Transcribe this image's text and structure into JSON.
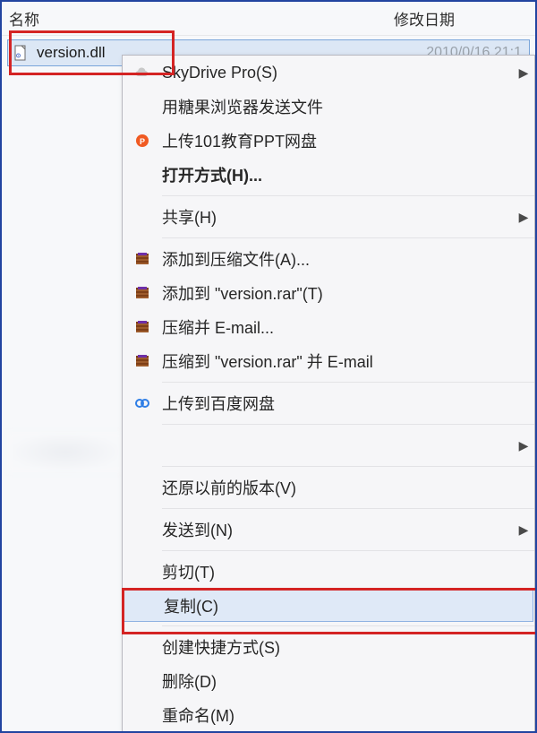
{
  "columns": {
    "name": "名称",
    "date": "修改日期"
  },
  "file": {
    "name": "version.dll",
    "date": "2010/0/16  21:1"
  },
  "menu": {
    "skydrive": "SkyDrive Pro(S)",
    "candy": "用糖果浏览器发送文件",
    "ppt101": "上传101教育PPT网盘",
    "openwith": "打开方式(H)...",
    "share": "共享(H)",
    "rarAdd": "添加到压缩文件(A)...",
    "rarAddName": "添加到 \"version.rar\"(T)",
    "rarEmail": "压缩并 E-mail...",
    "rarEmailName": "压缩到 \"version.rar\" 并 E-mail",
    "baidu": "上传到百度网盘",
    "restore": "还原以前的版本(V)",
    "sendto": "发送到(N)",
    "cut": "剪切(T)",
    "copy": "复制(C)",
    "shortcut": "创建快捷方式(S)",
    "delete": "删除(D)",
    "rename": "重命名(M)"
  }
}
